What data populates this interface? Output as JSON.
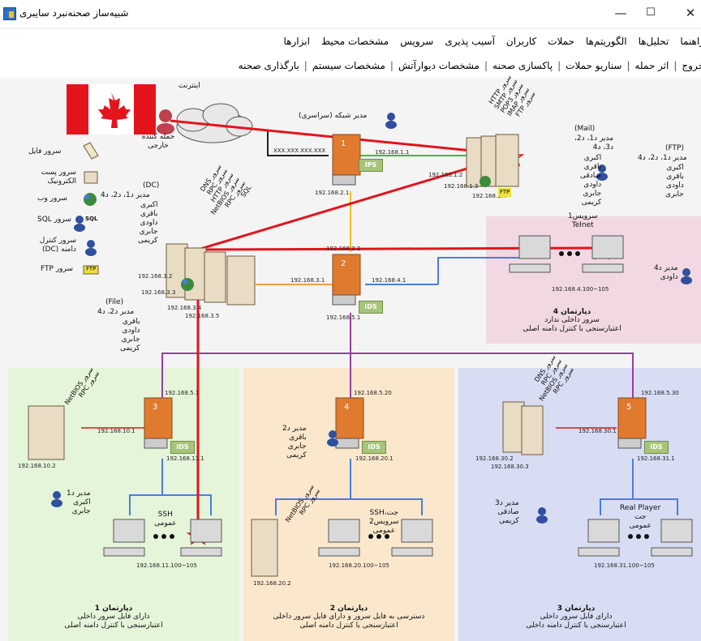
{
  "window": {
    "title": "شبیه‌ساز صحنه‌نبرد سایبری",
    "minimize": "—",
    "maximize": "☐",
    "close": "✕"
  },
  "menu_row1": [
    "ابزارها",
    "مشخصات محیط",
    "سرویس",
    "آسیب پذیری",
    "کاربران",
    "حملات",
    "الگوریتم‌ها",
    "تحلیل‌ها",
    "راهنما"
  ],
  "menu_row2": [
    "بارگذاری صحنه",
    "مشخصات سیستم",
    "مشخصات دیوارآتش",
    "پاکسازی صحنه",
    "سناریو حملات",
    "اثر حمله",
    "خروج"
  ],
  "legend": {
    "file_server": "سرور فایل",
    "mail_server": "سرور پست الکترونیک",
    "web_server": "سرور وب",
    "sql_server": "سرور SQL",
    "dc_server": "سرور کنترل دامنه (DC)",
    "ftp_server": "سرور FTP",
    "sql_tag": "SQL",
    "ftp_tag": "FTP"
  },
  "internet": {
    "label": "اینترنت",
    "attacker": "حمله کننده خارجی",
    "ip": "XXX.XXX.XXX.XXX"
  },
  "network_admin": "مدیر شبکه (سراسری)",
  "routers": {
    "r1": {
      "num": "1",
      "tag": "IPS",
      "ip_left": "192.168.2.1",
      "ip_right": "192.168.1.1"
    },
    "r2": {
      "num": "2",
      "tag": "IDS",
      "ip_top": "192.168.2.2",
      "ip_left": "192.168.3.1",
      "ip_right": "192.168.4.1",
      "ip_bottom": "192.168.5.1"
    },
    "r3": {
      "num": "3",
      "tag": "IDS",
      "ip_top": "192.168.5.1",
      "ip_left": "192.168.10.1",
      "ip_bottom": "192.168.11.1"
    },
    "r4": {
      "num": "4",
      "tag": "IDS",
      "ip_top": "192.168.5.20",
      "ip_bottom": "192.168.20.1"
    },
    "r5": {
      "num": "5",
      "tag": "IDS",
      "ip_top": "192.168.5.30",
      "ip_left": "192.168.30.1",
      "ip_bottom": "192.168.31.1"
    }
  },
  "mail_block": {
    "title": "(Mail)",
    "admins": "مدیر د1، د2،\nد3، د4",
    "names": "اکبری\nباقری\nصادقی\nداودی\nجابری\nکریمی",
    "ips": [
      "192.168.1.2",
      "192.168.1.3",
      "192.168.1.4"
    ],
    "services": "سرور HTTP\nسرور SMTP\nسرور POP3\nسرور IMAP\nسرور FTP",
    "ftp_tag": "FTP"
  },
  "ftp_block": {
    "title": "(FTP)",
    "admins": "مدیر د1، د2، د4",
    "names": "اکبری\nباقری\nداودی\nجابری"
  },
  "dc_block": {
    "title": "(DC)",
    "admins": "مدیر د1، د2، د4",
    "names": "اکبری\nباقری\nداودی\nجابری\nکریمی",
    "ips": [
      "192.168.3.2",
      "192.168.3.3",
      "192.168.3.4",
      "192.168.3.5"
    ],
    "services": "سرور DNS\nسرور RPC\nسرور HTTP\nسرور NetBIOS\nسرور RPC\nSQL"
  },
  "file_block": {
    "title": "(File)",
    "admins": "مدیر د2، د4",
    "names": "باقری\nداودی\nجابری\nکریمی"
  },
  "dept4": {
    "title": "دپارتمان 4",
    "desc1": "سرور داخلی ندارد",
    "desc2": "اعتبارسنجی با کنترل دامنه اصلی",
    "service": "سرویس1\nTelnet",
    "ip_range": "192.168.4.100~105",
    "admin": "مدیر د4\nداودی"
  },
  "dept1": {
    "title": "دپارتمان 1",
    "desc1": "دارای فایل سرور داخلی",
    "desc2": "اعتبارسنجی با کنترل دامنه اصلی",
    "server_services": "سرور NetBIOS\nسرور RPC",
    "server_ip": "192.168.10.2",
    "client_service": "SSH\nعمومی",
    "ip_range": "192.168.11.100~105",
    "admin": "مدیر د1\nاکبری\nجابری"
  },
  "dept2": {
    "title": "دپارتمان 2",
    "desc1": "دسترسی به فایل سرور و دارای فایل سرور داخلی",
    "desc2": "اعتبارسنجی با کنترل دامنه اصلی",
    "server_services": "سرور NetBIOS\nسرور RPC",
    "server_ip": "192.168.20.2",
    "client_service": "جت،SSH\nسرویس2\nعمومی",
    "ip_range": "192.168.20.100~105",
    "admin": "مدیر د2\nباقری\nجابری\nکریمی"
  },
  "dept3": {
    "title": "دپارتمان 3",
    "desc1": "دارای فایل سرور داخلی",
    "desc2": "اعتبارسنجی با کنترل دامنه داخلی",
    "server_services": "سرور DNS\nسرور RPC\nسرور NetBIOS\nسرور RPC",
    "server_ips": [
      "192.168.30.2",
      "192.168.30.3"
    ],
    "client_service": "Real Player\nجت\nعمومی",
    "ip_range": "192.168.31.100~105",
    "admin": "مدیر د3\nصادقی\nکریمی"
  },
  "dots": "● ● ●",
  "colors": {
    "attack_red": "#e4141c",
    "dept1_bg": "#e4f5d9",
    "dept2_bg": "#fbe8cc",
    "dept3_bg": "#d8ddf4",
    "dept4_bg": "#f1d8e2",
    "router_orange": "#e07a2e",
    "ids_green": "#a6c57a"
  }
}
